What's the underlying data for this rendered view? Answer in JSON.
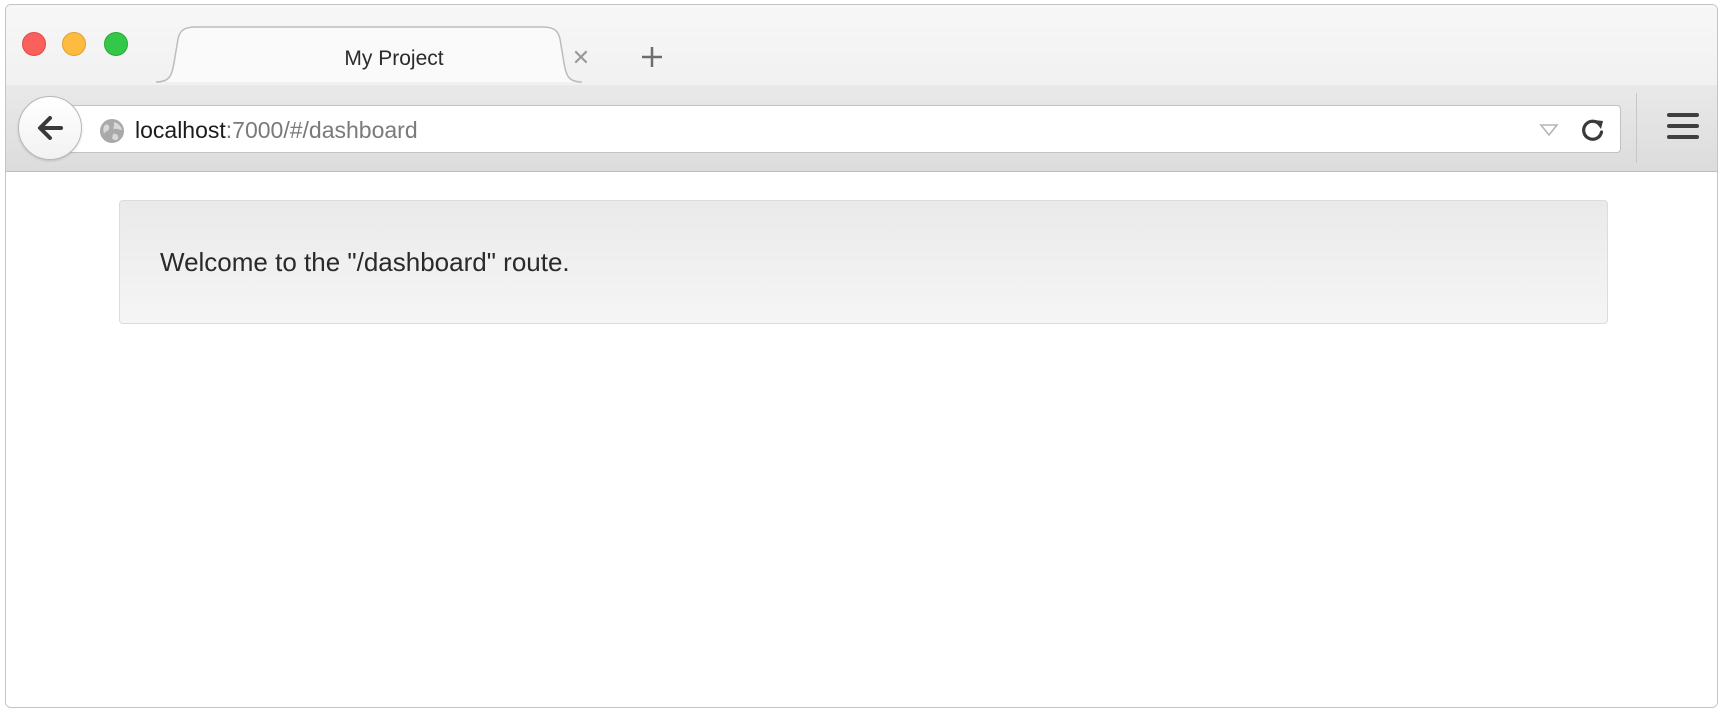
{
  "browser": {
    "tab": {
      "title": "My Project",
      "close_glyph": "✕"
    },
    "new_tab_icon": "plus-icon",
    "address": {
      "host": "localhost",
      "path": ":7000/#/dashboard"
    },
    "icons": {
      "back": "back-arrow-icon",
      "site": "globe-icon",
      "dropdown": "chevron-down-icon",
      "reload": "reload-icon",
      "menu": "hamburger-menu-icon"
    },
    "traffic_lights": {
      "close": "#fc605c",
      "minimize": "#fdbc40",
      "maximize": "#34c84a"
    }
  },
  "page": {
    "message": "Welcome to the \"/dashboard\" route."
  }
}
